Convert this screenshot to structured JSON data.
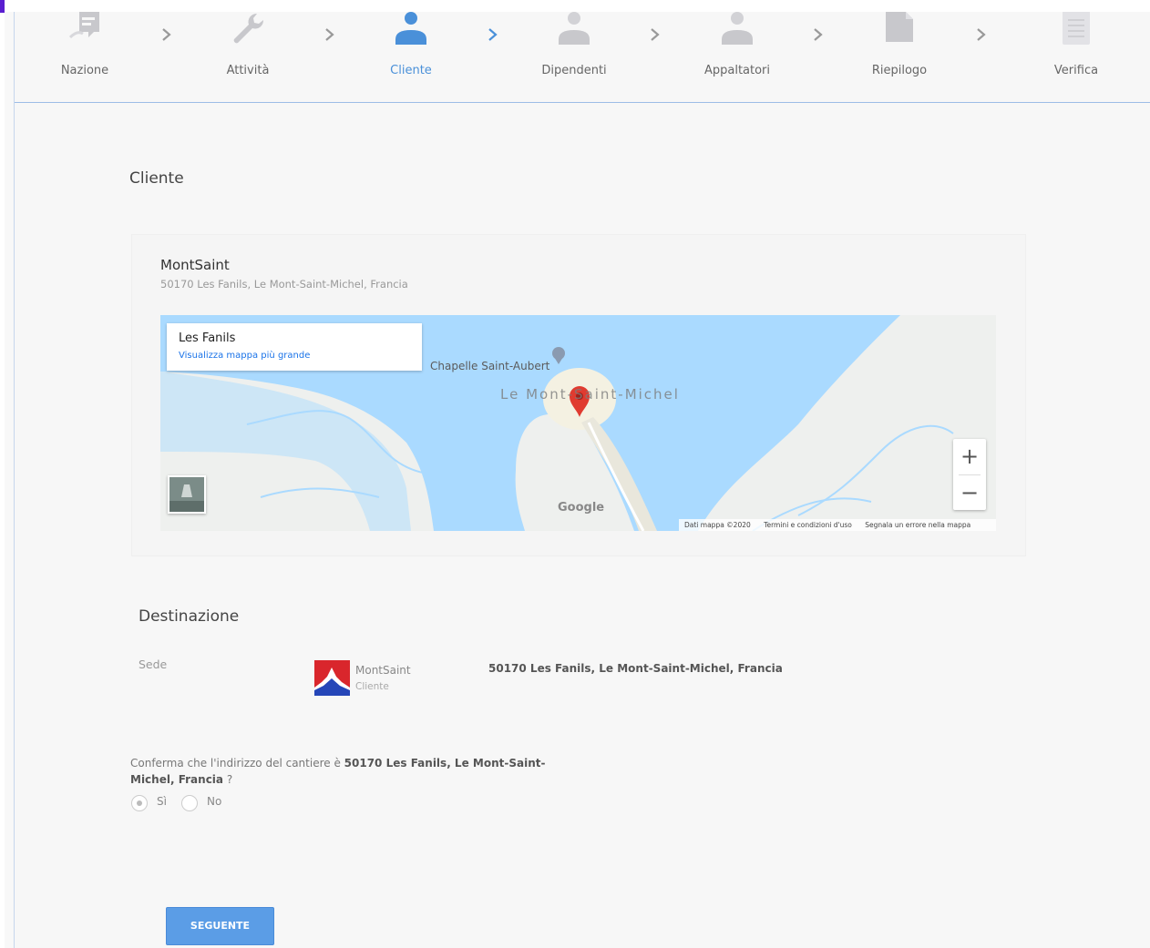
{
  "stepper": {
    "steps": [
      {
        "label": "Nazione",
        "icon": "flag-icon"
      },
      {
        "label": "Attività",
        "icon": "wrench-icon"
      },
      {
        "label": "Cliente",
        "icon": "person-icon",
        "active": true
      },
      {
        "label": "Dipendenti",
        "icon": "person-icon"
      },
      {
        "label": "Appaltatori",
        "icon": "person-icon"
      },
      {
        "label": "Riepilogo",
        "icon": "document-icon"
      },
      {
        "label": "Verifica",
        "icon": "checklist-icon"
      }
    ],
    "active_color": "#4a90d9"
  },
  "cliente": {
    "title": "Cliente",
    "card": {
      "name": "MontSaint",
      "address": "50170 Les Fanils, Le Mont-Saint-Michel, Francia"
    },
    "map": {
      "info_title": "Les Fanils",
      "info_link": "Visualizza mappa più grande",
      "label_chapelle": "Chapelle Saint-Aubert",
      "label_mont": "Le Mont-Saint-Michel",
      "zoom_in": "+",
      "zoom_out": "−",
      "google": "Google",
      "attribution": [
        "Dati mappa ©2020",
        "Termini e condizioni d'uso",
        "Segnala un errore nella mappa"
      ]
    }
  },
  "destinazione": {
    "title": "Destinazione",
    "sede_label": "Sede",
    "name": "MontSaint",
    "sub": "Cliente",
    "address": "50170 Les Fanils, Le Mont-Saint-Michel, Francia"
  },
  "confirm": {
    "prefix": "Conferma che l'indirizzo del cantiere è ",
    "address": "50170 Les Fanils, Le Mont-Saint-Michel, Francia",
    "suffix": "?",
    "options": [
      "Sì",
      "No"
    ],
    "selected": "Sì"
  },
  "next_button": "SEGUENTE",
  "colors": {
    "accent": "#5b9de6",
    "water": "#aadaff",
    "land": "#eef0ee"
  }
}
